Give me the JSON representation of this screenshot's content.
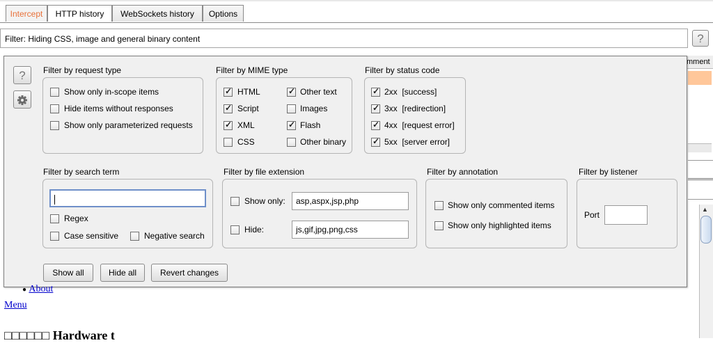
{
  "tabs": [
    {
      "label": "Intercept"
    },
    {
      "label": "HTTP history"
    },
    {
      "label": "WebSockets history"
    },
    {
      "label": "Options"
    }
  ],
  "filter_bar": {
    "text": "Filter: Hiding CSS, image and general binary content",
    "help": "?"
  },
  "background": {
    "column_header": "mment"
  },
  "panel": {
    "help": "?",
    "request_type": {
      "title": "Filter by request type",
      "items": [
        {
          "label": "Show only in-scope items",
          "checked": false
        },
        {
          "label": "Hide items without responses",
          "checked": false
        },
        {
          "label": "Show only parameterized requests",
          "checked": false
        }
      ]
    },
    "mime": {
      "title": "Filter by MIME type",
      "items": [
        {
          "label": "HTML",
          "checked": true
        },
        {
          "label": "Script",
          "checked": true
        },
        {
          "label": "XML",
          "checked": true
        },
        {
          "label": "CSS",
          "checked": false
        },
        {
          "label": "Other text",
          "checked": true
        },
        {
          "label": "Images",
          "checked": false
        },
        {
          "label": "Flash",
          "checked": true
        },
        {
          "label": "Other binary",
          "checked": false
        }
      ]
    },
    "status": {
      "title": "Filter by status code",
      "items": [
        {
          "label": "2xx  [success]",
          "checked": true
        },
        {
          "label": "3xx  [redirection]",
          "checked": true
        },
        {
          "label": "4xx  [request error]",
          "checked": true
        },
        {
          "label": "5xx  [server error]",
          "checked": true
        }
      ]
    },
    "search": {
      "title": "Filter by search term",
      "value": "",
      "regex": "Regex",
      "case_sensitive": "Case sensitive",
      "negative": "Negative search"
    },
    "extension": {
      "title": "Filter by file extension",
      "show_only_label": "Show only:",
      "show_only_value": "asp,aspx,jsp,php",
      "hide_label": "Hide:",
      "hide_value": "js,gif,jpg,png,css"
    },
    "annotation": {
      "title": "Filter by annotation",
      "commented": "Show only commented items",
      "highlighted": "Show only highlighted items"
    },
    "listener": {
      "title": "Filter by listener",
      "port_label": "Port",
      "port_value": ""
    },
    "buttons": {
      "show_all": "Show all",
      "hide_all": "Hide all",
      "revert": "Revert changes"
    }
  },
  "page": {
    "about": "About",
    "menu": "Menu",
    "heading_boxes": "□□□□□□",
    "heading_text": "Hardware t"
  }
}
